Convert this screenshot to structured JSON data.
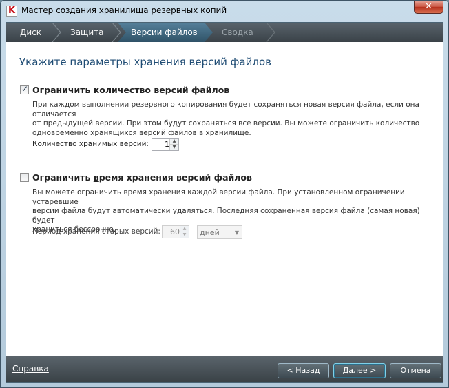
{
  "window": {
    "title": "Мастер создания хранилища резервных копий",
    "close_label": "✕"
  },
  "steps": [
    {
      "label": "Диск",
      "state": "done"
    },
    {
      "label": "Защита",
      "state": "done"
    },
    {
      "label": "Версии файлов",
      "state": "active"
    },
    {
      "label": "Сводка",
      "state": "disabled"
    }
  ],
  "page": {
    "heading": "Укажите параметры хранения версий файлов"
  },
  "limit_count": {
    "checked": true,
    "label_pre": "Ограничить ",
    "label_access": "к",
    "label_post": "оличество версий файлов",
    "desc_lines": [
      "При каждом выполнении резервного копирования будет сохраняться новая версия файла, если она отличается",
      "от предыдущей версии. При этом будут сохраняться все версии. Вы можете ограничить количество",
      "одновременно хранящихся версий файлов в хранилище."
    ],
    "field_label": "Количество хранимых версий:",
    "value": "1"
  },
  "limit_time": {
    "checked": false,
    "label_pre": "Ограничить ",
    "label_access": "в",
    "label_post": "ремя хранения версий файлов",
    "desc_lines": [
      "Вы можете ограничить время хранения каждой версии файла. При установленном ограничении устаревшие",
      "версии файла будут автоматически удаляться. Последняя сохраненная версия файла (самая новая) будет",
      "храниться бессрочно."
    ],
    "field_label": "Период хранения старых версий:",
    "value": "60",
    "unit": "дней"
  },
  "footer": {
    "help": "Справка",
    "back_pre": "< ",
    "back_access": "Н",
    "back_post": "азад",
    "next_access": "Д",
    "next_post": "алее >",
    "cancel": "Отмена"
  },
  "colors": {
    "heading": "#1f4c74",
    "bar_dark": "#3a4248",
    "active_step": "#2f5267"
  }
}
